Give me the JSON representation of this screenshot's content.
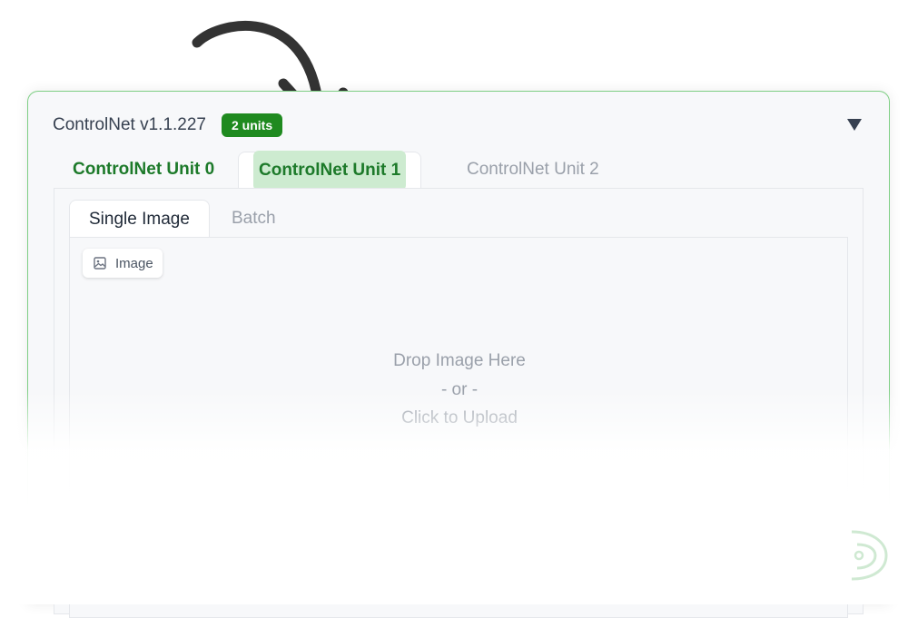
{
  "header": {
    "title": "ControlNet v1.1.227",
    "badge": "2 units"
  },
  "unit_tabs": [
    "ControlNet Unit 0",
    "ControlNet Unit 1",
    "ControlNet Unit 2"
  ],
  "active_unit_tab": "ControlNet Unit 1",
  "image_tabs": [
    "Single Image",
    "Batch"
  ],
  "active_image_tab": "Single Image",
  "upload": {
    "label": "Image",
    "drop_line": "Drop Image Here",
    "or_line": "- or -",
    "click_line": "Click to Upload"
  },
  "icons": {
    "collapse": "triangle-down-icon",
    "image": "image-icon",
    "arrow": "curved-arrow-icon",
    "watermark": "logo-icon"
  },
  "colors": {
    "accent_green": "#1d7a2a",
    "badge_green": "#1f8a1f",
    "highlight": "#cdebd0",
    "panel_border": "#7fcf85"
  }
}
